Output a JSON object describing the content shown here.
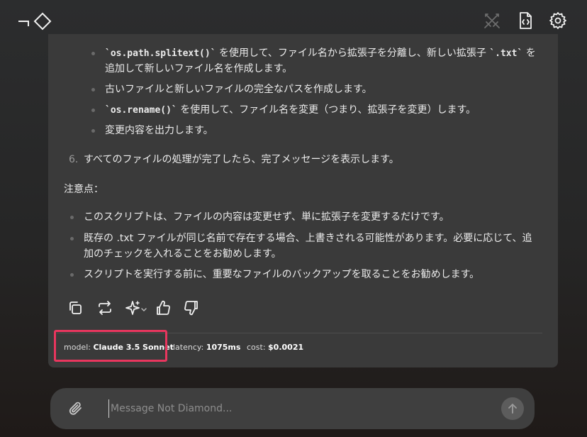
{
  "header": {
    "logo_text": "¬◇",
    "icons": [
      "swords-crossed-icon",
      "code-file-icon",
      "settings-gear-icon"
    ]
  },
  "message": {
    "sub_bullets": [
      {
        "code": "`os.path.splitext()`",
        "text_a": " を使用して、ファイル名から拡張子を分離し、新しい拡張子 ",
        "code2": "`.txt`",
        "text_b": " を",
        "cont": "追加して新しいファイル名を作成します。"
      },
      {
        "text": "古いファイルと新しいファイルの完全なパスを作成します。"
      },
      {
        "code": "`os.rename()`",
        "text_a": " を使用して、ファイル名を変更（つまり、拡張子を変更）します。"
      },
      {
        "text": "変更内容を出力します。"
      }
    ],
    "step6_number": "6.",
    "step6_text": "すべてのファイルの処理が完了したら、完了メッセージを表示します。",
    "notes_heading": "注意点：",
    "notes": [
      {
        "text": "このスクリプトは、ファイルの内容は変更せず、単に拡張子を変更するだけです。"
      },
      {
        "text": "既存の .txt ファイルが同じ名前で存在する場合、上書きされる可能性があります。必要に応じて、追",
        "cont": "加のチェックを入れることをお勧めします。"
      },
      {
        "text": "スクリプトを実行する前に、重要なファイルのバックアップを取ることをお勧めします。"
      }
    ]
  },
  "actions": [
    "copy-icon",
    "regenerate-icon",
    "sparkle-icon",
    "thumbs-up-icon",
    "thumbs-down-icon"
  ],
  "meta": {
    "model_label": "model:",
    "model_value": "Claude 3.5 Sonnet",
    "latency_label": "latency:",
    "latency_value": "1075ms",
    "cost_label": "cost:",
    "cost_value": "$0.0021"
  },
  "composer": {
    "placeholder": "Message Not Diamond...",
    "value": ""
  },
  "colors": {
    "highlight": "#e8365e",
    "card": "#3a3a3a",
    "composer": "#3f3f3f"
  }
}
